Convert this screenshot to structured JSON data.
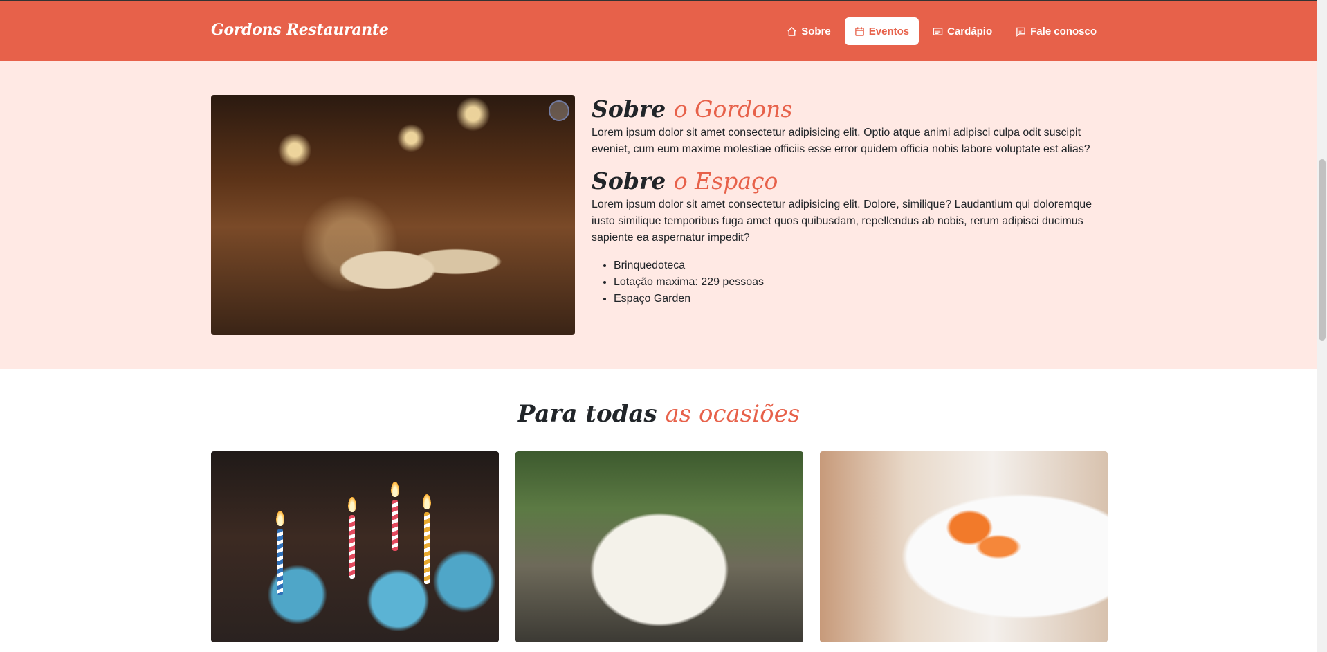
{
  "navbar": {
    "brand": "Gordons Restaurante",
    "items": [
      {
        "label": "Sobre",
        "icon": "home-icon",
        "active": false
      },
      {
        "label": "Eventos",
        "icon": "calendar-icon",
        "active": true
      },
      {
        "label": "Cardápio",
        "icon": "menu-card-icon",
        "active": false
      },
      {
        "label": "Fale conosco",
        "icon": "chat-icon",
        "active": false
      }
    ]
  },
  "about": {
    "heading1": {
      "prefix": "Sobre",
      "accent": "o Gordons"
    },
    "text1": "Lorem ipsum dolor sit amet consectetur adipisicing elit. Optio atque animi adipisci culpa odit suscipit eveniet, cum eum maxime molestiae officiis esse error quidem officia nobis labore voluptate est alias?",
    "heading2": {
      "prefix": "Sobre",
      "accent": "o Espaço"
    },
    "text2": "Lorem ipsum dolor sit amet consectetur adipisicing elit. Dolore, similique? Laudantium qui doloremque iusto similique temporibus fuga amet quos quibusdam, repellendus ab nobis, rerum adipisci ducimus sapiente ea aspernatur impedit?",
    "features": [
      "Brinquedoteca",
      "Lotação maxima: 229 pessoas",
      "Espaço Garden"
    ]
  },
  "occasions": {
    "title": {
      "prefix": "Para todas",
      "accent": "as ocasiões"
    },
    "cards": [
      {
        "image": "birthday-cupcakes-image"
      },
      {
        "image": "wedding-table-image"
      },
      {
        "image": "toast-drinks-image"
      }
    ]
  },
  "colors": {
    "accent": "#e7614a",
    "about_bg": "#ffe9e4"
  }
}
